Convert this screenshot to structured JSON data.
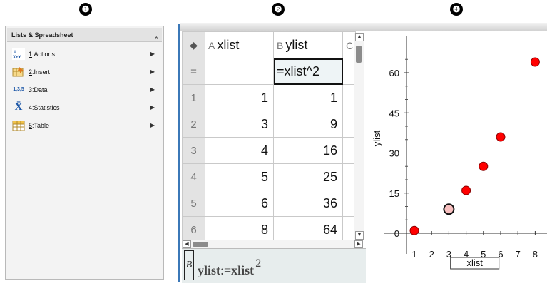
{
  "callouts": [
    "❶",
    "❷",
    "❸",
    "❹"
  ],
  "menu": {
    "title": "Lists & Spreadsheet",
    "collapse_icon": "double-chevron-up",
    "items": [
      {
        "key": "1",
        "label": "Actions",
        "icon": "actions-icon"
      },
      {
        "key": "2",
        "label": "Insert",
        "icon": "insert-icon"
      },
      {
        "key": "3",
        "label": "Data",
        "icon": "data-icon",
        "icon_text": "1,3,5"
      },
      {
        "key": "4",
        "label": "Statistics",
        "icon": "statistics-icon",
        "icon_text": "X̄"
      },
      {
        "key": "5",
        "label": "Table",
        "icon": "table-icon"
      }
    ]
  },
  "spreadsheet": {
    "header_icon": "tag-icon",
    "formula_row_label": "=",
    "columns": [
      {
        "letter": "A",
        "name": "xlist",
        "formula": ""
      },
      {
        "letter": "B",
        "name": "ylist",
        "formula": "=xlist^2"
      },
      {
        "letter": "C",
        "name": "",
        "formula": ""
      }
    ],
    "rows": [
      {
        "n": "1",
        "a": "1",
        "b": "1"
      },
      {
        "n": "2",
        "a": "3",
        "b": "9"
      },
      {
        "n": "3",
        "a": "4",
        "b": "16"
      },
      {
        "n": "4",
        "a": "5",
        "b": "25"
      },
      {
        "n": "5",
        "a": "6",
        "b": "36"
      },
      {
        "n": "6",
        "a": "8",
        "b": "64"
      }
    ]
  },
  "entry_line": {
    "cell_ref": "B",
    "var": "ylist",
    "op": ":=",
    "expr": "xlist",
    "exponent": "2"
  },
  "chart_data": {
    "type": "scatter",
    "x": [
      1,
      3,
      4,
      5,
      6,
      8
    ],
    "y": [
      1,
      9,
      16,
      25,
      36,
      64
    ],
    "highlighted_point": {
      "x": 3,
      "y": 9
    },
    "xlabel": "xlist",
    "ylabel": "ylist",
    "xticks": [
      "1",
      "2",
      "3",
      "4",
      "5",
      "6",
      "7",
      "8"
    ],
    "yticks": [
      "0",
      "15",
      "30",
      "45",
      "60"
    ],
    "xlim": [
      0,
      8.6
    ],
    "ylim": [
      -3,
      70
    ],
    "point_color": "#ff0000",
    "highlight_color": "#f8c0c0"
  }
}
